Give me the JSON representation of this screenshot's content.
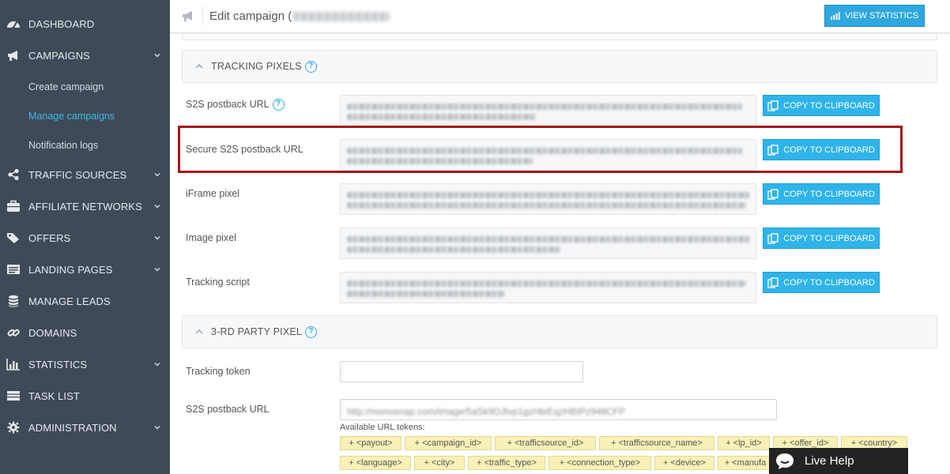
{
  "sidebar": {
    "items": [
      {
        "label": "DASHBOARD",
        "icon": "dashboard-icon"
      },
      {
        "label": "CAMPAIGNS",
        "icon": "megaphone-icon"
      },
      {
        "label": "TRAFFIC SOURCES",
        "icon": "share-icon"
      },
      {
        "label": "AFFILIATE NETWORKS",
        "icon": "briefcase-icon"
      },
      {
        "label": "OFFERS",
        "icon": "tags-icon"
      },
      {
        "label": "LANDING PAGES",
        "icon": "page-icon"
      },
      {
        "label": "MANAGE LEADS",
        "icon": "database-icon"
      },
      {
        "label": "DOMAINS",
        "icon": "link-icon"
      },
      {
        "label": "STATISTICS",
        "icon": "bar-chart-icon"
      },
      {
        "label": "TASK LIST",
        "icon": "list-icon"
      },
      {
        "label": "ADMINISTRATION",
        "icon": "gear-icon"
      }
    ],
    "campaign_subitems": [
      "Create campaign",
      "Manage campaigns",
      "Notification logs"
    ]
  },
  "header": {
    "title": "Edit campaign (",
    "view_statistics_label": "VIEW STATISTICS"
  },
  "tracking_pixels": {
    "title": "TRACKING PIXELS",
    "rows": [
      {
        "label": "S2S postback URL"
      },
      {
        "label": "Secure S2S postback URL"
      },
      {
        "label": "iFrame pixel"
      },
      {
        "label": "Image pixel"
      },
      {
        "label": "Tracking script"
      }
    ],
    "copy_label": "COPY TO CLIPBOARD"
  },
  "third_party": {
    "title": "3-RD PARTY PIXEL",
    "tracking_token_label": "Tracking token",
    "tracking_token_value": "",
    "s2s_label": "S2S postback URL",
    "s2s_value": "http://monosnap.com/image/5aSk9DJtvp1gzHbiEqzHBIPz948CFP",
    "tokens_label": "Available URL tokens:",
    "tokens": [
      "+ <payout>",
      "+ <campaign_id>",
      "+ <trafficsource_id>",
      "+ <trafficsource_name>",
      "+ <lp_id>",
      "+ <offer_id>",
      "+ <country>",
      "+ <language>",
      "+ <city>",
      "+ <traffic_type>",
      "+ <connection_type>",
      "+ <device>",
      "+ <manufa"
    ]
  },
  "live_help": {
    "label": "Live Help"
  },
  "colors": {
    "sidebar": "#3e4a57",
    "accent": "#2fa8e0",
    "active_link": "#3fb8e8",
    "highlight": "#a5171b",
    "token_bg": "#f8f1b8"
  }
}
